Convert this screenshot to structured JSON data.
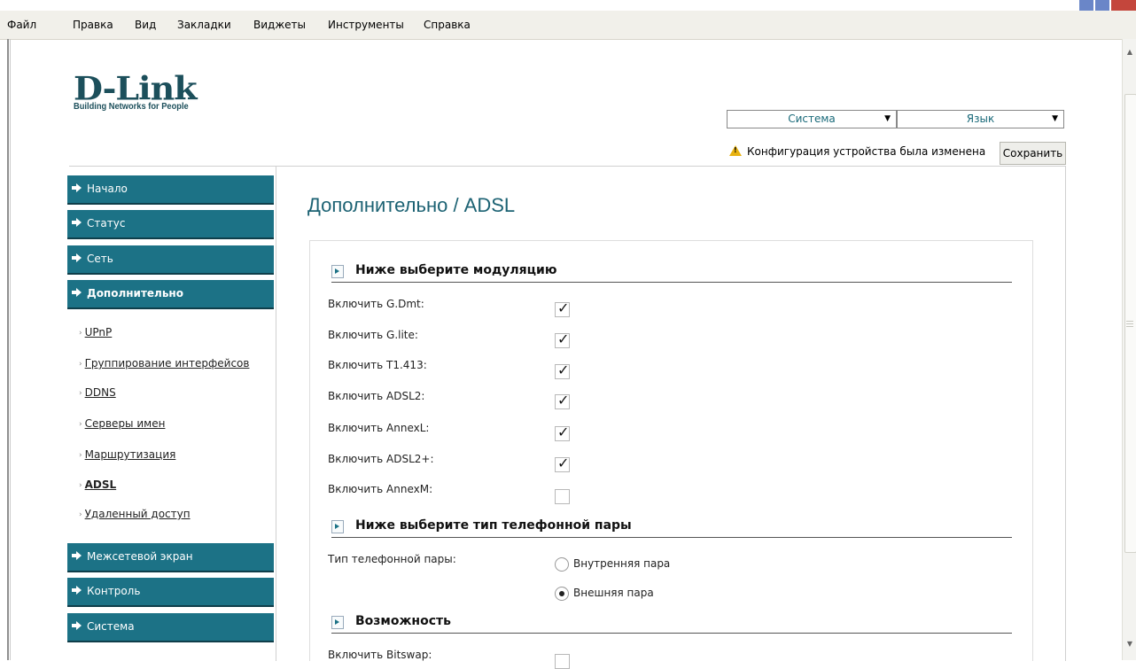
{
  "menu": [
    "Файл",
    "Правка",
    "Вид",
    "Закладки",
    "Виджеты",
    "Инструменты",
    "Справка"
  ],
  "brand": {
    "name": "D-Link",
    "tagline": "Building Networks for People"
  },
  "header": {
    "system_select": "Система",
    "language_select": "Язык",
    "warning": "Конфигурация устройства была изменена",
    "save_label": "Сохранить"
  },
  "sidebar": {
    "top_items": [
      {
        "label": "Начало"
      },
      {
        "label": "Статус"
      },
      {
        "label": "Сеть"
      },
      {
        "label": "Дополнительно"
      }
    ],
    "sub_items": [
      {
        "label": "UPnP"
      },
      {
        "label": "Группирование интерфейсов"
      },
      {
        "label": "DDNS"
      },
      {
        "label": "Серверы имен"
      },
      {
        "label": "Маршрутизация"
      },
      {
        "label": "ADSL"
      },
      {
        "label": "Удаленный доступ"
      }
    ],
    "bottom_items": [
      {
        "label": "Межсетевой экран"
      },
      {
        "label": "Контроль"
      },
      {
        "label": "Система"
      }
    ]
  },
  "page": {
    "title": "Дополнительно /  ADSL",
    "section_modulation": "Ниже выберите модуляцию",
    "modulation": [
      {
        "label": "Включить G.Dmt:",
        "checked": true
      },
      {
        "label": "Включить G.lite:",
        "checked": true
      },
      {
        "label": "Включить T1.413:",
        "checked": true
      },
      {
        "label": "Включить ADSL2:",
        "checked": true
      },
      {
        "label": "Включить AnnexL:",
        "checked": true
      },
      {
        "label": "Включить ADSL2+:",
        "checked": true
      },
      {
        "label": "Включить AnnexM:",
        "checked": false
      }
    ],
    "section_pair": "Ниже выберите тип телефонной пары",
    "pair_label": "Тип телефонной пары:",
    "pair_options": [
      {
        "label": "Внутренняя пара",
        "selected": false
      },
      {
        "label": "Внешняя пара",
        "selected": true
      }
    ],
    "section_feature": "Возможность",
    "bitswap_label": "Включить Bitswap:",
    "check_mark": "✓"
  }
}
